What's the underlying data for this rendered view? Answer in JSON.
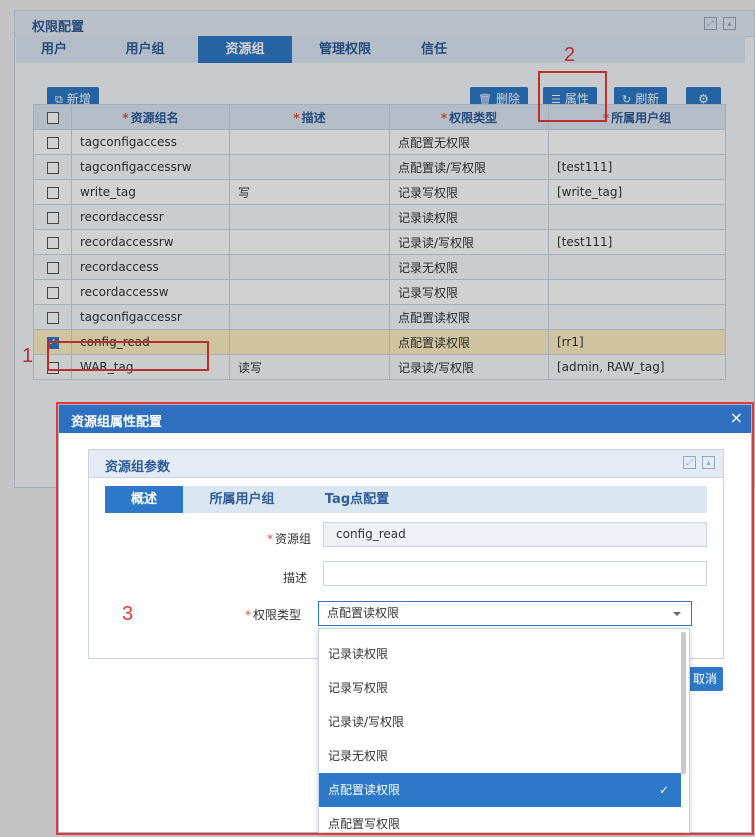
{
  "panel": {
    "title": "权限配置"
  },
  "tabs": [
    "用户",
    "用户组",
    "资源组",
    "管理权限",
    "信任"
  ],
  "active_tab": "资源组",
  "toolbar": {
    "add": "新增",
    "delete": "删除",
    "properties": "属性",
    "refresh": "刷新"
  },
  "table": {
    "columns": [
      "资源组名",
      "描述",
      "权限类型",
      "所属用户组"
    ],
    "rows": [
      {
        "name": "tagconfigaccess",
        "desc": "",
        "type": "点配置无权限",
        "groups": ""
      },
      {
        "name": "tagconfigaccessrw",
        "desc": "",
        "type": "点配置读/写权限",
        "groups": "[test111]"
      },
      {
        "name": "write_tag",
        "desc": "写",
        "type": "记录写权限",
        "groups": "[write_tag]"
      },
      {
        "name": "recordaccessr",
        "desc": "",
        "type": "记录读权限",
        "groups": ""
      },
      {
        "name": "recordaccessrw",
        "desc": "",
        "type": "记录读/写权限",
        "groups": "[test111]"
      },
      {
        "name": "recordaccess",
        "desc": "",
        "type": "记录无权限",
        "groups": ""
      },
      {
        "name": "recordaccessw",
        "desc": "",
        "type": "记录写权限",
        "groups": ""
      },
      {
        "name": "tagconfigaccessr",
        "desc": "",
        "type": "点配置读权限",
        "groups": ""
      },
      {
        "name": "config_read",
        "desc": "",
        "type": "点配置读权限",
        "groups": "[rr1]",
        "selected": true
      },
      {
        "name": "WAR_tag",
        "desc": "读写",
        "type": "记录读/写权限",
        "groups": "[admin, RAW_tag]"
      }
    ]
  },
  "annotations": {
    "one": "1",
    "two": "2",
    "three": "3"
  },
  "dialog": {
    "title": "资源组属性配置",
    "close": "×",
    "panel_title": "资源组参数",
    "tabs": [
      "概述",
      "所属用户组",
      "Tag点配置"
    ],
    "fields": {
      "group_label": "资源组",
      "group_value": "config_read",
      "desc_label": "描述",
      "desc_value": "",
      "type_label": "权限类型",
      "type_value": "点配置读权限"
    },
    "cancel": "取消",
    "options": [
      "记录读权限",
      "记录写权限",
      "记录读/写权限",
      "记录无权限",
      "点配置读权限",
      "点配置写权限"
    ],
    "selected_option": "点配置读权限"
  },
  "colors": {
    "accent": "#2e79c7",
    "annotation": "#e53935",
    "selected_row": "#fdf0c2"
  }
}
